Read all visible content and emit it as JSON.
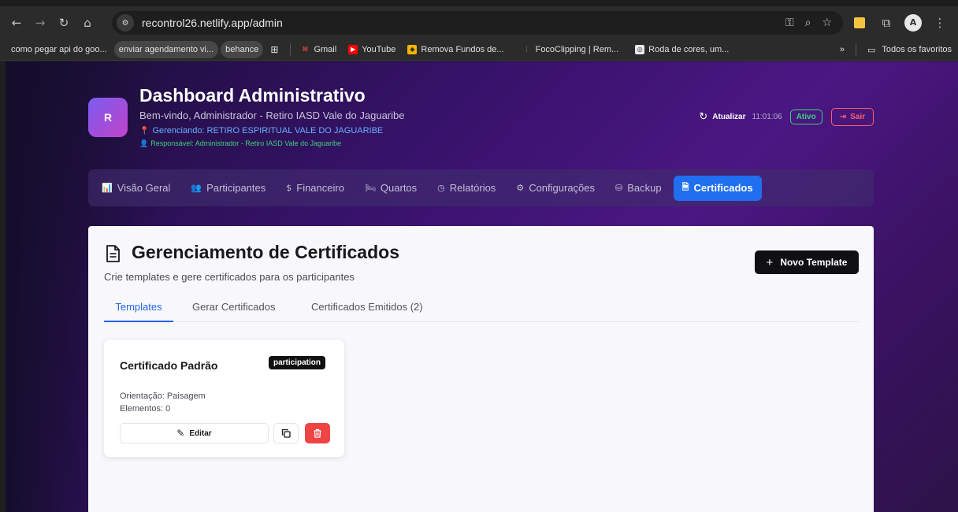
{
  "browser": {
    "url": "recontrol26.netlify.app/admin",
    "bookmarks": [
      {
        "label": "como pegar api do goo...",
        "pill": false
      },
      {
        "label": "enviar agendamento vi...",
        "pill": true
      },
      {
        "label": "behance",
        "pill": true
      }
    ],
    "bookmarks2": [
      {
        "label": "Gmail",
        "icon": "gmail-icon",
        "color": "#ea4335"
      },
      {
        "label": "YouTube",
        "icon": "youtube-icon",
        "color": "#ff0000"
      },
      {
        "label": "Remova Fundos de...",
        "icon": "remove-bg-icon",
        "color": "#f5b400"
      },
      {
        "label": "FocoClipping | Rem...",
        "icon": "fococlipping-icon",
        "color": "#9aa0a6"
      },
      {
        "label": "Roda de cores, um...",
        "icon": "color-wheel-icon",
        "color": "#e8eaed"
      }
    ],
    "overflow_label": "»",
    "all_bookmarks": "Todos os favoritos"
  },
  "header": {
    "avatar_letter": "R",
    "title": "Dashboard Administrativo",
    "welcome": "Bem-vindo, Administrador - Retiro IASD Vale do Jaguaribe",
    "managing": "Gerenciando: RETIRO ESPIRITUAL VALE DO JAGUARIBE",
    "responsible": "Responsável: Administrador - Retiro IASD Vale do Jaguaribe",
    "refresh_label": "Atualizar",
    "time": "11:01:06",
    "status": "Ativo",
    "logout": "Sair"
  },
  "nav": {
    "items": [
      {
        "label": "Visão Geral",
        "icon": "chart-icon"
      },
      {
        "label": "Participantes",
        "icon": "users-icon"
      },
      {
        "label": "Financeiro",
        "icon": "dollar-icon"
      },
      {
        "label": "Quartos",
        "icon": "bed-icon"
      },
      {
        "label": "Relatórios",
        "icon": "clock-icon"
      },
      {
        "label": "Configurações",
        "icon": "gear-icon"
      },
      {
        "label": "Backup",
        "icon": "database-icon"
      },
      {
        "label": "Certificados",
        "icon": "document-icon"
      }
    ],
    "active": "Certificados"
  },
  "main": {
    "title": "Gerenciamento de Certificados",
    "subtitle": "Crie templates e gere certificados para os participantes",
    "new_template": "Novo Template",
    "tabs": [
      {
        "label": "Templates",
        "active": true
      },
      {
        "label": "Gerar Certificados",
        "active": false
      },
      {
        "label": "Certificados Emitidos (2)",
        "active": false
      }
    ],
    "template": {
      "name": "Certificado Padrão",
      "type": "participation",
      "orientation": "Orientação: Paisagem",
      "elements": "Elementos: 0",
      "edit": "Editar"
    }
  },
  "colors": {
    "accent": "#1f6ff0",
    "danger": "#ef4444",
    "success": "#39d07d"
  }
}
